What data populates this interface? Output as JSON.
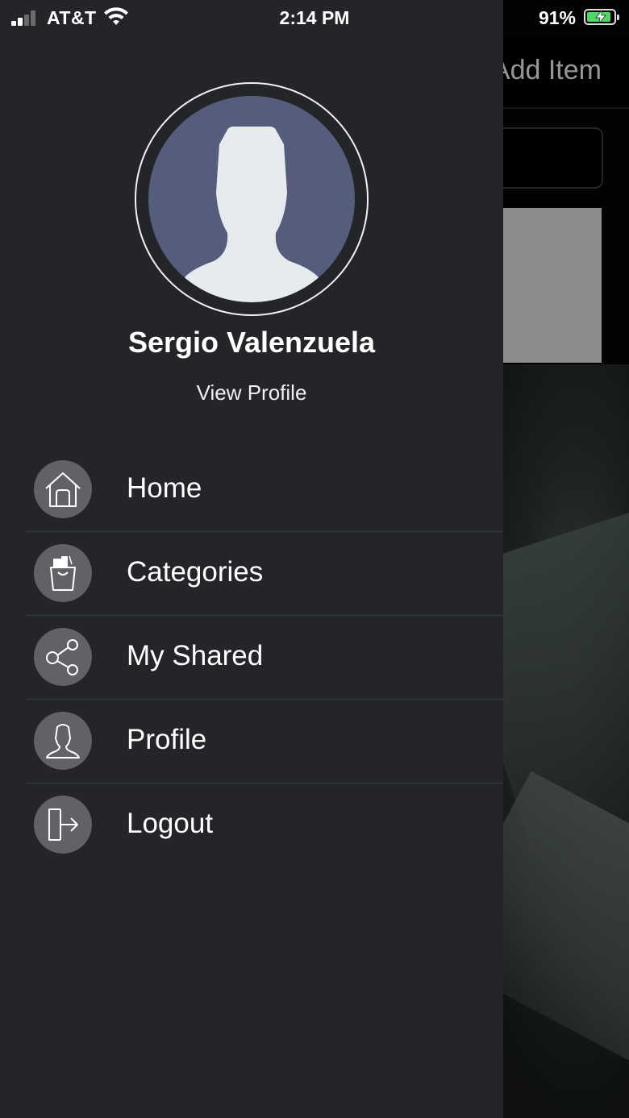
{
  "status_bar": {
    "carrier": "AT&T",
    "time": "2:14 PM",
    "battery_percent": "91%",
    "battery_level": 0.91,
    "signal_bars": 2
  },
  "background_screen": {
    "title": "Add Item"
  },
  "drawer": {
    "user_name": "Sergio Valenzuela",
    "view_profile_label": "View Profile",
    "avatar_icon": "default-user-avatar",
    "menu_items": [
      {
        "label": "Home",
        "icon": "home-icon"
      },
      {
        "label": "Categories",
        "icon": "shopping-bag-icon"
      },
      {
        "label": "My Shared",
        "icon": "share-icon"
      },
      {
        "label": "Profile",
        "icon": "user-icon"
      },
      {
        "label": "Logout",
        "icon": "logout-icon"
      }
    ]
  },
  "colors": {
    "drawer_bg": "#232528",
    "icon_circle": "#606265",
    "avatar_bg": "#565d7c",
    "battery_fill": "#4cd964"
  }
}
